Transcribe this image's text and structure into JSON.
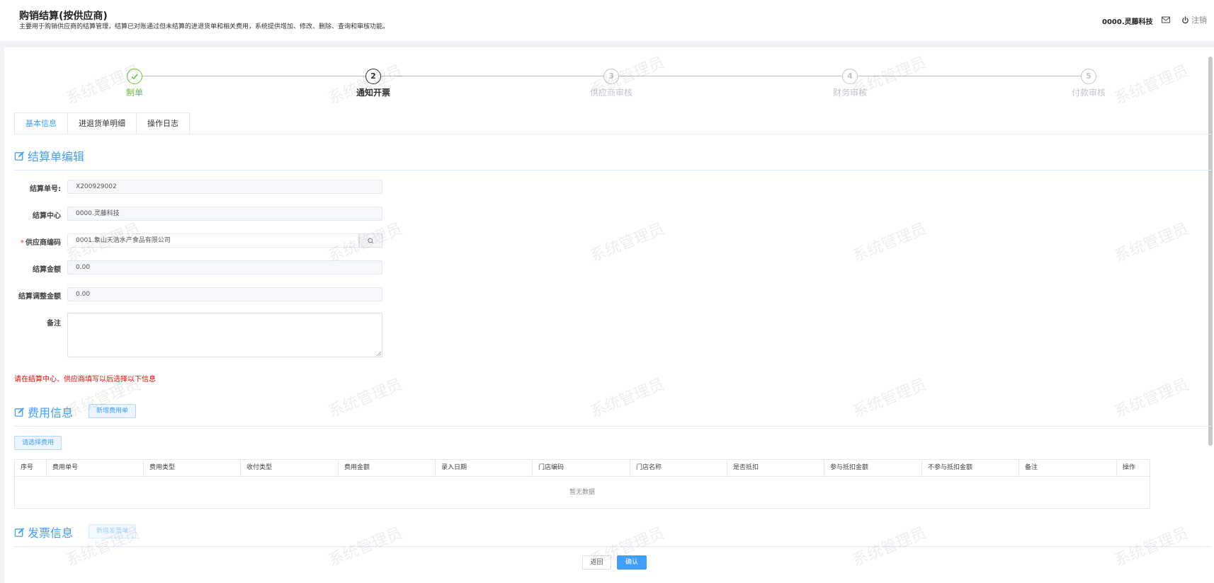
{
  "header": {
    "title": "购销结算(按供应商)",
    "description": "主要用于购销供应商的结算管理，结算已对账通过但未结算的进退货单和相关费用，系统提供增加、修改、删除、查询和审核功能。",
    "user": "0000.灵藤科技",
    "logout_label": "注销"
  },
  "watermark": "系统管理员",
  "steps": [
    {
      "number": "1",
      "label": "制单",
      "status": "done"
    },
    {
      "number": "2",
      "label": "通知开票",
      "status": "active"
    },
    {
      "number": "3",
      "label": "供应商审核",
      "status": "pending"
    },
    {
      "number": "4",
      "label": "财务审核",
      "status": "pending"
    },
    {
      "number": "5",
      "label": "付款审核",
      "status": "pending"
    }
  ],
  "tabs": [
    "基本信息",
    "进退货单明细",
    "操作日志"
  ],
  "active_tab": "基本信息",
  "settlement": {
    "section_title": "结算单编辑",
    "fields": {
      "bill_no": {
        "label": "结算单号:",
        "value": "X200929002"
      },
      "center": {
        "label": "结算中心",
        "value": "0000.灵藤科技"
      },
      "supplier": {
        "label": "供应商编码",
        "value": "0001.象山天浩水产食品有限公司"
      },
      "amount": {
        "label": "结算金额",
        "value": "0.00"
      },
      "adjust_amount": {
        "label": "结算调整金额",
        "value": "0.00"
      },
      "remark": {
        "label": "备注",
        "value": ""
      }
    },
    "warning": "请在结算中心、供应商填写以后选择以下信息"
  },
  "fees": {
    "section_title": "费用信息",
    "add_button": "新增费用单",
    "select_button": "请选择费用",
    "columns": [
      "序号",
      "费用单号",
      "费用类型",
      "收付类型",
      "费用金额",
      "录入日期",
      "门店编码",
      "门店名称",
      "是否抵扣",
      "参与抵扣金额",
      "不参与抵扣金额",
      "备注",
      "操作"
    ],
    "empty_text": "暂无数据"
  },
  "invoice": {
    "section_title": "发票信息",
    "add_button": "新增发票单"
  },
  "footer": {
    "back_button": "返回",
    "confirm_button": "确认"
  },
  "colors": {
    "primary": "#409eff",
    "success": "#67c23a",
    "danger": "#ff0000"
  }
}
